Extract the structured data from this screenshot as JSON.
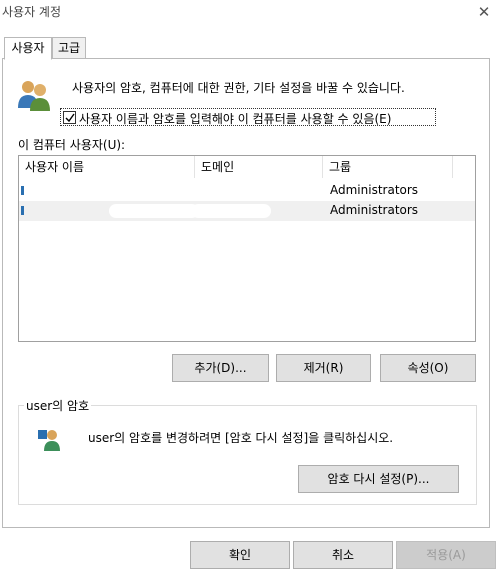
{
  "window": {
    "title": "사용자 계정",
    "close_glyph": "✕"
  },
  "tabs": [
    {
      "label": "사용자",
      "active": true
    },
    {
      "label": "고급",
      "active": false
    }
  ],
  "intro_text": "사용자의 암호, 컴퓨터에 대한 권한, 기타 설정을 바꿀 수 있습니다.",
  "checkbox": {
    "label": "사용자 이름과 암호를 입력해야 이 컴퓨터를 사용할 수 있음(E)",
    "checked": true
  },
  "users_list": {
    "label": "이 컴퓨터 사용자(U):",
    "columns": [
      "사용자 이름",
      "도메인",
      "그룹"
    ],
    "rows": [
      {
        "name": "",
        "domain": "",
        "group": "Administrators",
        "selected": false
      },
      {
        "name": "",
        "domain": "",
        "group": "Administrators",
        "selected": true
      }
    ]
  },
  "buttons": {
    "add": "추가(D)...",
    "remove": "제거(R)",
    "properties": "속성(O)"
  },
  "password_group": {
    "title": "user의 암호",
    "text": "user의 암호를 변경하려면 [암호 다시 설정]을 클릭하십시오.",
    "reset_button": "암호 다시 설정(P)..."
  },
  "footer": {
    "ok": "확인",
    "cancel": "취소",
    "apply": "적용(A)"
  },
  "colors": {
    "panel_border": "#b9b9b9",
    "button_bg": "#e1e1e1",
    "selected_row": "#f0f0f0"
  },
  "icons": [
    "close-icon",
    "users-icon",
    "checkmark-icon",
    "user-row-icon",
    "password-user-icon"
  ]
}
